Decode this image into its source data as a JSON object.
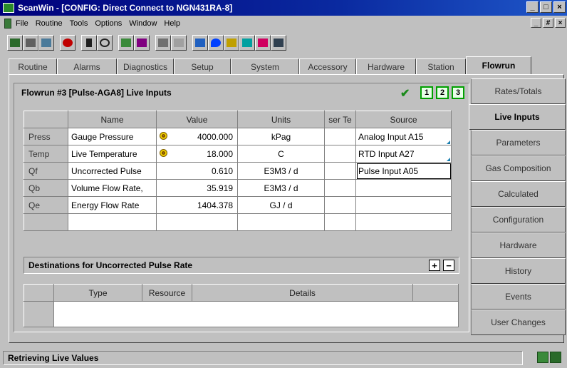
{
  "window": {
    "title": "ScanWin - [CONFIG: Direct Connect to NGN431RA-8]",
    "buttons": [
      "_",
      "□",
      "×"
    ]
  },
  "menu": {
    "items": [
      "File",
      "Routine",
      "Tools",
      "Options",
      "Window",
      "Help"
    ],
    "mdi_buttons": [
      "_",
      "#",
      "×"
    ]
  },
  "toolbar": {
    "icons": [
      "connect-icon",
      "print-icon",
      "preview-icon",
      "stop-icon",
      "pointer-icon",
      "zoom-icon",
      "trend-icon",
      "chart-icon",
      "calc-icon",
      "notes-icon",
      "network-icon",
      "water-icon",
      "meter-icon",
      "lock-icon",
      "alarm-icon",
      "display-icon"
    ]
  },
  "tabs": [
    "Routine",
    "Alarms",
    "Diagnostics",
    "Setup",
    "System",
    "Accessory",
    "Hardware",
    "Station",
    "Flowrun"
  ],
  "panel": {
    "title": "Flowrun #3 [Pulse-AGA8] Live Inputs",
    "run_buttons": [
      "1",
      "2",
      "3"
    ]
  },
  "live_inputs": {
    "headers": [
      "",
      "Name",
      "Value",
      "Units",
      "ser Te",
      "Source"
    ],
    "rows": [
      {
        "code": "Press",
        "name": "Gauge Pressure",
        "gauge": true,
        "value": "4000.000",
        "units": "kPag",
        "user": "",
        "source": "Analog Input A15"
      },
      {
        "code": "Temp",
        "name": "Live Temperature",
        "gauge": true,
        "value": "18.000",
        "units": "C",
        "user": "",
        "source": "RTD Input A27"
      },
      {
        "code": "Qf",
        "name": "Uncorrected Pulse",
        "gauge": false,
        "value": "0.610",
        "units": "E3M3 / d",
        "user": "",
        "source": "Pulse Input A05"
      },
      {
        "code": "Qb",
        "name": "Volume Flow Rate,",
        "gauge": false,
        "value": "35.919",
        "units": "E3M3 / d",
        "user": "",
        "source": ""
      },
      {
        "code": "Qe",
        "name": "Energy Flow Rate",
        "gauge": false,
        "value": "1404.378",
        "units": "GJ / d",
        "user": "",
        "source": ""
      }
    ]
  },
  "destinations": {
    "title": "Destinations for Uncorrected Pulse Rate",
    "add": "+",
    "remove": "−",
    "headers": [
      "",
      "Type",
      "Resource",
      "Details",
      ""
    ]
  },
  "side_tabs": [
    "Rates/Totals",
    "Live Inputs",
    "Parameters",
    "Gas Composition",
    "Calculated",
    "Configuration",
    "Hardware",
    "History",
    "Events",
    "User Changes"
  ],
  "status": {
    "text": "Retrieving Live Values"
  }
}
